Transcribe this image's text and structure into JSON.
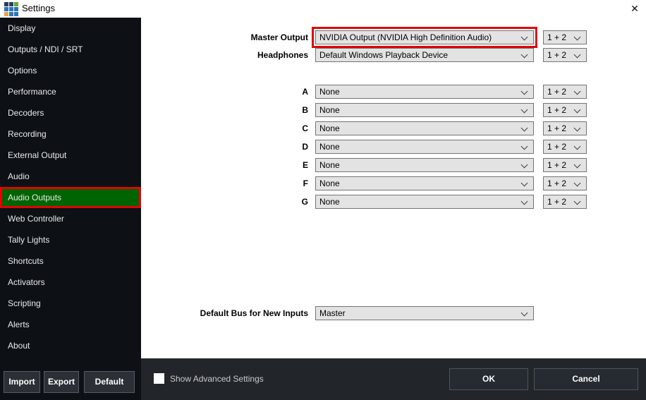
{
  "window": {
    "title": "Settings",
    "close_glyph": "✕"
  },
  "colors": {
    "sidebar_bg": "#0d1116",
    "active_green": "#006400",
    "highlight_red": "#e00404",
    "bottombar_bg": "#22262b",
    "combo_bg": "#e3e3e3"
  },
  "logo": {
    "squares": [
      "#24415e",
      "#24415e",
      "#6aa63c",
      "#2e74b8",
      "#2e74b8",
      "#2e74b8",
      "#eda33c",
      "#2e74b8",
      "#2e74b8"
    ]
  },
  "sidebar": {
    "items": [
      {
        "label": "Display",
        "active": false
      },
      {
        "label": "Outputs / NDI / SRT",
        "active": false
      },
      {
        "label": "Options",
        "active": false
      },
      {
        "label": "Performance",
        "active": false
      },
      {
        "label": "Decoders",
        "active": false
      },
      {
        "label": "Recording",
        "active": false
      },
      {
        "label": "External Output",
        "active": false
      },
      {
        "label": "Audio",
        "active": false
      },
      {
        "label": "Audio Outputs",
        "active": true
      },
      {
        "label": "Web Controller",
        "active": false
      },
      {
        "label": "Tally Lights",
        "active": false
      },
      {
        "label": "Shortcuts",
        "active": false
      },
      {
        "label": "Activators",
        "active": false
      },
      {
        "label": "Scripting",
        "active": false
      },
      {
        "label": "Alerts",
        "active": false
      },
      {
        "label": "About",
        "active": false
      }
    ],
    "buttons": [
      "Import",
      "Export",
      "Default"
    ]
  },
  "main": {
    "master_output": {
      "label": "Master Output",
      "value": "NVIDIA Output (NVIDIA High Definition Audio)",
      "channel": "1 + 2",
      "highlighted": true
    },
    "headphones": {
      "label": "Headphones",
      "value": "Default Windows Playback Device",
      "channel": "1 + 2"
    },
    "bus_rows": [
      {
        "label": "A",
        "value": "None",
        "channel": "1 + 2"
      },
      {
        "label": "B",
        "value": "None",
        "channel": "1 + 2"
      },
      {
        "label": "C",
        "value": "None",
        "channel": "1 + 2"
      },
      {
        "label": "D",
        "value": "None",
        "channel": "1 + 2"
      },
      {
        "label": "E",
        "value": "None",
        "channel": "1 + 2"
      },
      {
        "label": "F",
        "value": "None",
        "channel": "1 + 2"
      },
      {
        "label": "G",
        "value": "None",
        "channel": "1 + 2"
      }
    ],
    "default_bus": {
      "label": "Default Bus for New Inputs",
      "value": "Master"
    }
  },
  "footer": {
    "checkbox_label": "Show Advanced Settings",
    "checkbox_checked": false,
    "ok_label": "OK",
    "cancel_label": "Cancel"
  }
}
